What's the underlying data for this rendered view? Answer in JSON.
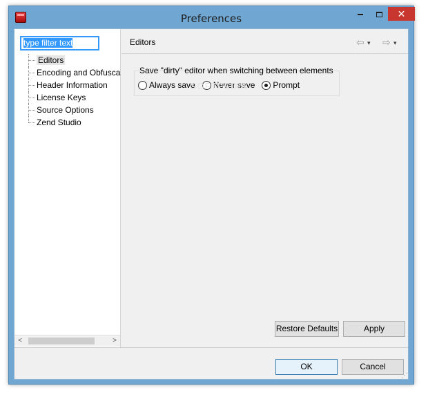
{
  "window": {
    "title": "Preferences",
    "close_label": "✕"
  },
  "filter": {
    "text": "type filter text"
  },
  "tree": {
    "items": [
      {
        "label": "Editors",
        "selected": true
      },
      {
        "label": "Encoding and Obfusca"
      },
      {
        "label": "Header Information"
      },
      {
        "label": "License Keys"
      },
      {
        "label": "Source Options"
      },
      {
        "label": "Zend Studio"
      }
    ]
  },
  "page": {
    "title": "Editors",
    "nav_back_icon": "⇦",
    "nav_forward_icon": "⇨",
    "dropdown_icon": "▾"
  },
  "group": {
    "label": "Save \"dirty\" editor when switching between elements",
    "options": [
      {
        "label": "Always save",
        "checked": false
      },
      {
        "label": "Never save",
        "checked": false
      },
      {
        "label": "Prompt",
        "checked": true
      }
    ]
  },
  "watermark": "SOFTPEDIA",
  "buttons": {
    "restore_defaults": "Restore Defaults",
    "apply": "Apply",
    "ok": "OK",
    "cancel": "Cancel"
  },
  "scrollbar": {
    "left_arrow": "<",
    "right_arrow": ">"
  }
}
